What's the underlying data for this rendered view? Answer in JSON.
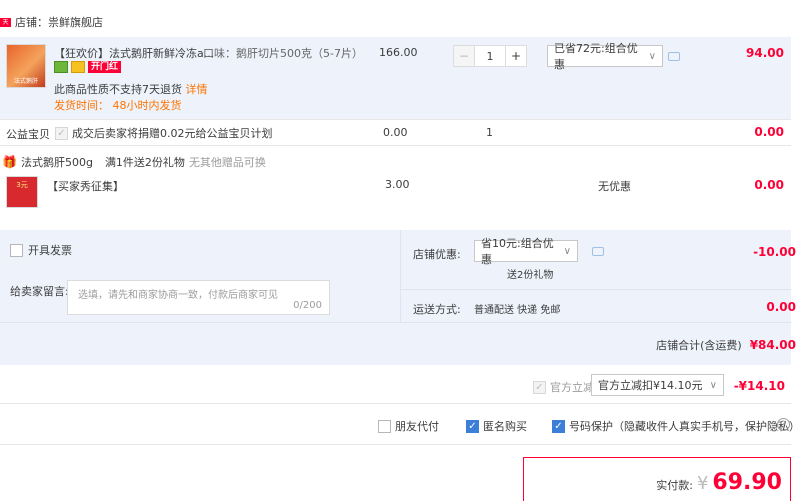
{
  "shop": {
    "badge": "天猫",
    "label": "店铺：",
    "name": "祟鲜旗舰店"
  },
  "item": {
    "title": "【狂欢价】法式鹅肝新鲜冷冻a...",
    "spec": "口味：鹅肝切片500克（5-7片）",
    "price": "166.00",
    "qty": "1",
    "minus": "−",
    "plus": "+",
    "discount_select": "已省72元:组合优惠",
    "subtotal": "94.00",
    "badge_label": "开门红",
    "no_return": "此商品性质不支持7天退货",
    "detail_link": "详情",
    "ship_time": "发货时间： 48小时内发货",
    "thumb_caption": "法式鹅肝"
  },
  "charity": {
    "label": "公益宝贝",
    "desc": "成交后卖家将捐赠0.02元给公益宝贝计划",
    "price": "0.00",
    "qty": "1",
    "subtotal": "0.00"
  },
  "gift": {
    "name": "法式鹅肝500g",
    "promo": "满1件送2份礼物",
    "note": "无其他赠品可换"
  },
  "gift_item": {
    "title": "【买家秀征集】",
    "price": "3.00",
    "discount": "无优惠",
    "subtotal": "0.00",
    "thumb_caption": "3元"
  },
  "invoice": {
    "label": "开具发票"
  },
  "message": {
    "label": "给卖家留言:",
    "placeholder": "选填，请先和商家协商一致，付款后商家可见",
    "counter": "0/200"
  },
  "shop_discount": {
    "label": "店铺优惠:",
    "select": "省10元:组合优惠",
    "gift_note": "送2份礼物",
    "amount": "-10.00"
  },
  "shipping": {
    "label": "运送方式:",
    "method": "普通配送 快递 免邮",
    "amount": "0.00"
  },
  "shop_total": {
    "label": "店铺合计(含运费)",
    "amount": "¥84.00"
  },
  "official": {
    "label": "官方立减",
    "select": "官方立减扣¥14.10元",
    "amount": "-¥14.10"
  },
  "options": {
    "friend": "朋友代付",
    "anon": "匿名购买",
    "privacy": "号码保护（隐藏收件人真实手机号，保护隐私）",
    "help": "?"
  },
  "payment": {
    "label": "实付款:",
    "currency": "¥",
    "amount": "69.90"
  },
  "colors": {
    "accent": "#ff0036",
    "orange": "#ff7300",
    "band": "#eef3fb",
    "check": "#3d7fd8"
  }
}
